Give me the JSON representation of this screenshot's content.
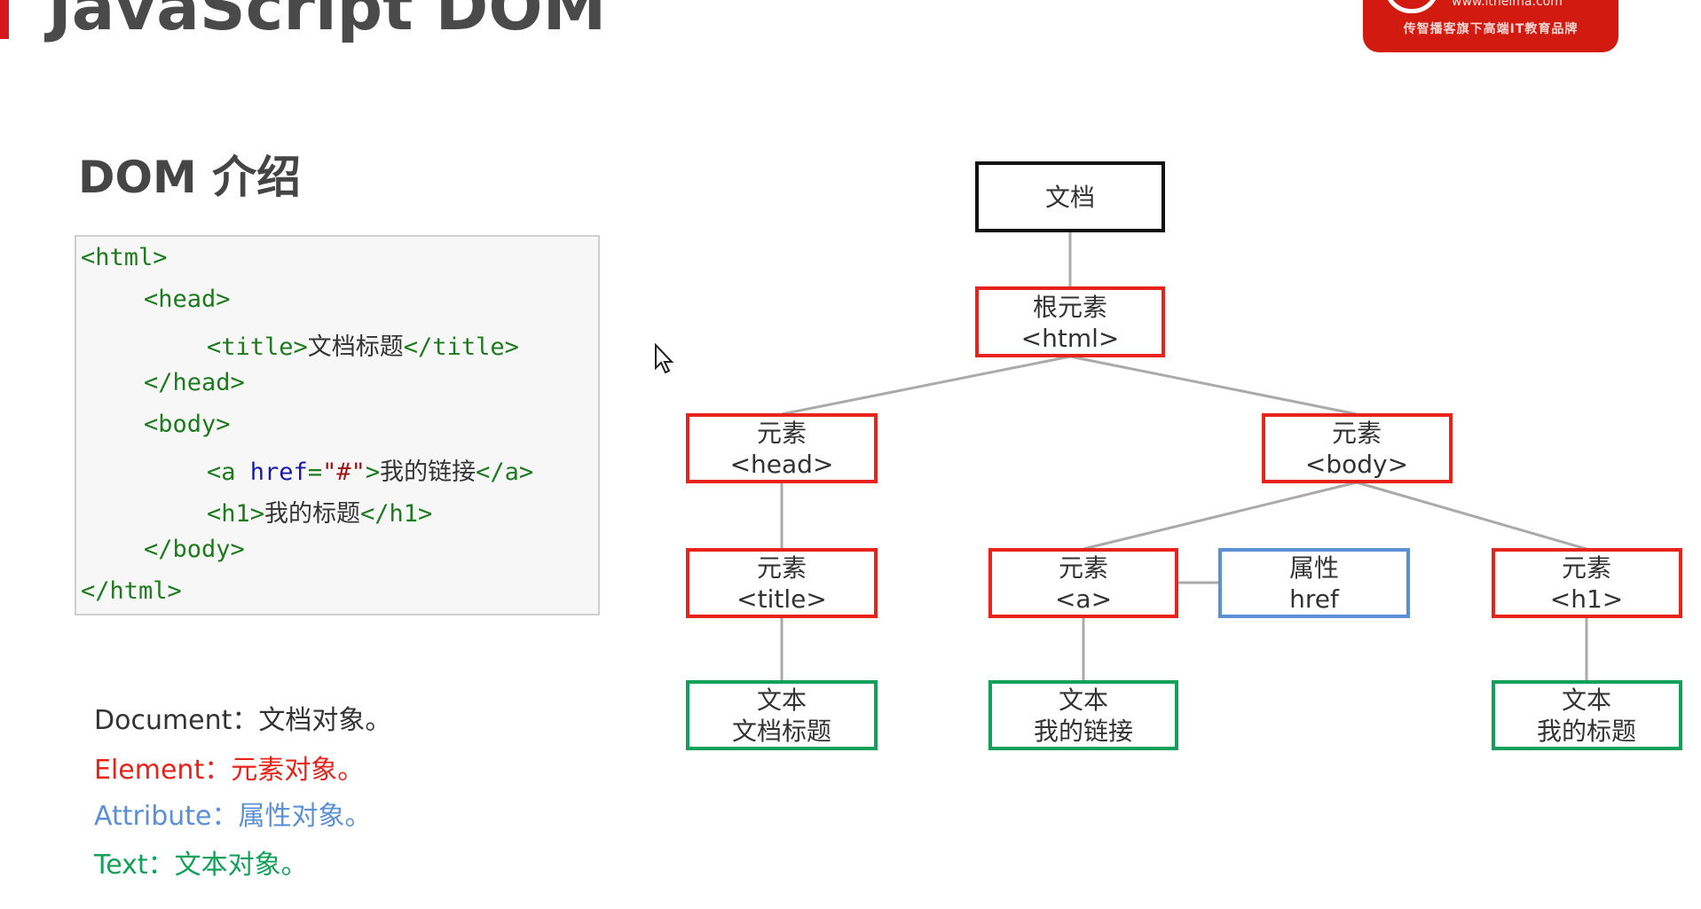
{
  "header": {
    "title": "JavaScript DOM"
  },
  "logo": {
    "url": "www.itheima.com",
    "slogan": "传智播客旗下高端IT教育品牌"
  },
  "section": {
    "title": "DOM 介绍"
  },
  "code": {
    "lines": [
      "<html>",
      "<head>",
      "<title>",
      "文档标题",
      "</title>",
      "</head>",
      "<body>",
      "<a ",
      "href",
      "=",
      "\"#\"",
      ">",
      "我的链接",
      "</a>",
      "<h1>",
      "我的标题",
      "</h1>",
      "</body>",
      "</html>"
    ]
  },
  "legend": {
    "document": "Document：文档对象。",
    "element": "Element：元素对象。",
    "attribute": "Attribute：属性对象。",
    "text": "Text：文本对象。"
  },
  "colors": {
    "element": "#e8231b",
    "attribute": "#5b8fd6",
    "text": "#12a05a",
    "document": "#111111",
    "connector": "#aaaaaa"
  },
  "tree": {
    "document": {
      "line1": "文档"
    },
    "root": {
      "line1": "根元素",
      "line2": "<html>"
    },
    "head": {
      "line1": "元素",
      "line2": "<head>"
    },
    "body": {
      "line1": "元素",
      "line2": "<body>"
    },
    "title": {
      "line1": "元素",
      "line2": "<title>"
    },
    "a": {
      "line1": "元素",
      "line2": "<a>"
    },
    "href": {
      "line1": "属性",
      "line2": "href"
    },
    "h1": {
      "line1": "元素",
      "line2": "<h1>"
    },
    "text_title": {
      "line1": "文本",
      "line2": "文档标题"
    },
    "text_a": {
      "line1": "文本",
      "line2": "我的链接"
    },
    "text_h1": {
      "line1": "文本",
      "line2": "我的标题"
    }
  }
}
